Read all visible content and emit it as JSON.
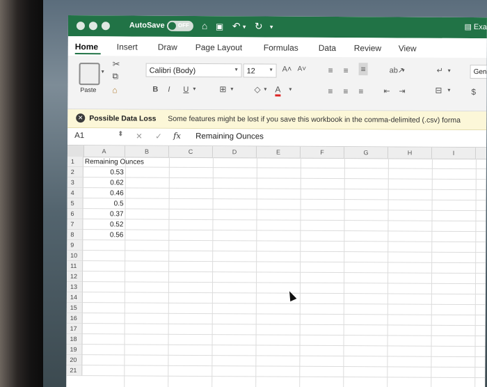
{
  "titlebar": {
    "autosave_label": "AutoSave",
    "autosave_state": "OFF",
    "doc_name": "Exa"
  },
  "ribbon_tabs": [
    "Home",
    "Insert",
    "Draw",
    "Page Layout",
    "Formulas",
    "Data",
    "Review",
    "View"
  ],
  "ribbon": {
    "paste_label": "Paste",
    "font_name": "Calibri (Body)",
    "font_size": "12",
    "number_format": "Gen",
    "currency_symbol": "$"
  },
  "message_bar": {
    "title": "Possible Data Loss",
    "text": "Some features might be lost if you save this workbook in the comma-delimited (.csv) forma"
  },
  "formula_bar": {
    "name_box": "A1",
    "fx": "fx",
    "value": "Remaining Ounces"
  },
  "sheet": {
    "columns": [
      "A",
      "B",
      "C",
      "D",
      "E",
      "F",
      "G",
      "H",
      "I"
    ],
    "rows": [
      "1",
      "2",
      "3",
      "4",
      "5",
      "6",
      "7",
      "8",
      "9",
      "10",
      "11",
      "12",
      "13",
      "14",
      "15",
      "16",
      "17",
      "18",
      "19",
      "20",
      "21"
    ],
    "cells": {
      "A1": "Remaining Ounces",
      "A2": "0.53",
      "A3": "0.62",
      "A4": "0.46",
      "A5": "0.5",
      "A6": "0.37",
      "A7": "0.52",
      "A8": "0.56"
    }
  }
}
